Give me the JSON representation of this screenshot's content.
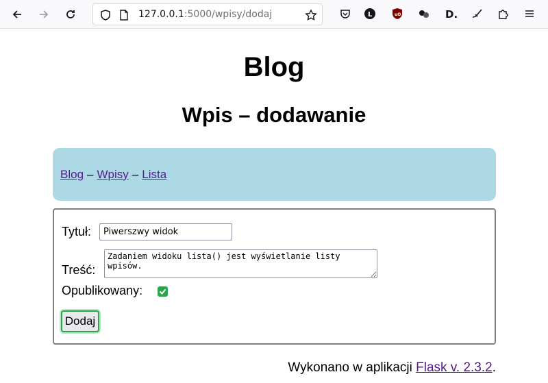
{
  "browser": {
    "url_host": "127.0.0.1",
    "url_rest": ":5000/wpisy/dodaj"
  },
  "page": {
    "title": "Blog",
    "subtitle": "Wpis – dodawanie"
  },
  "nav": {
    "links": [
      "Blog",
      "Wpisy",
      "Lista"
    ],
    "separator": "–"
  },
  "form": {
    "title_label": "Tytuł:",
    "title_value": "Piwerszwy widok",
    "content_label": "Treść:",
    "content_value": "Zadaniem widoku lista() jest wyświetlanie listy wpisów.",
    "published_label": "Opublikowany:",
    "published_checked": true,
    "submit_label": "Dodaj"
  },
  "footer": {
    "text": "Wykonano w aplikacji",
    "link": "Flask v. 2.3.2",
    "end": "."
  },
  "colors": {
    "nav_bg": "#add8e6",
    "link": "#551a8b",
    "accent": "#2ea44f"
  }
}
